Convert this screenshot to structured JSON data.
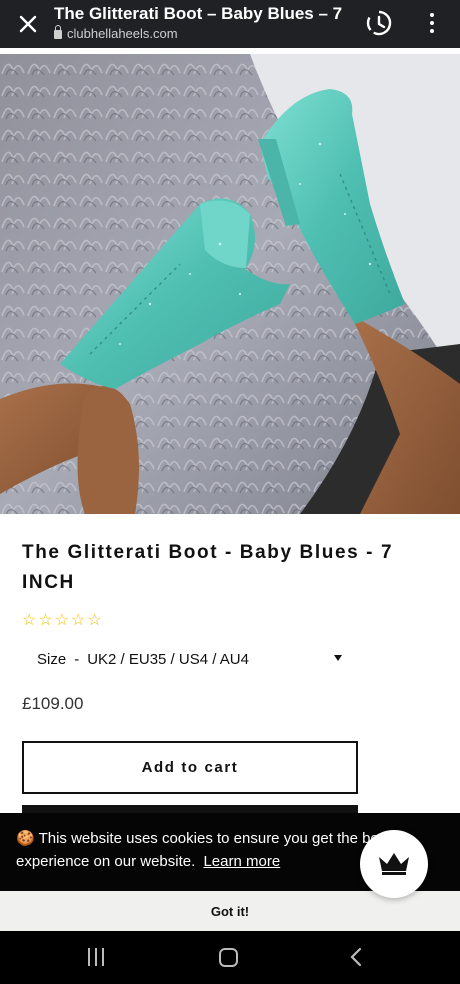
{
  "browser": {
    "title": "The Glitterati Boot – Baby Blues – 7",
    "url": "clubhellaheels.com"
  },
  "product": {
    "title": "The Glitterati Boot - Baby Blues - 7 INCH",
    "rating_stars": 0,
    "rating_max": 5,
    "size_label": "Size",
    "size_separator": "-",
    "size_value": "UK2 / EU35 / US4 / AU4",
    "price": "£109.00",
    "add_to_cart": "Add to cart"
  },
  "cookie": {
    "message": "🍪 This website uses cookies to ensure you get the best experience on our website.",
    "learn_more": "Learn more",
    "got_it": "Got it!"
  },
  "colors": {
    "topbar": "#202124",
    "star": "#f2c200",
    "boot": "#5cc9bd",
    "banner": "#050505"
  },
  "icons": [
    "close-icon",
    "lock-icon",
    "history-icon",
    "more-vert-icon",
    "star-outline-icon",
    "caret-down-icon",
    "crown-icon",
    "nav-recents-icon",
    "nav-home-icon",
    "nav-back-icon"
  ]
}
